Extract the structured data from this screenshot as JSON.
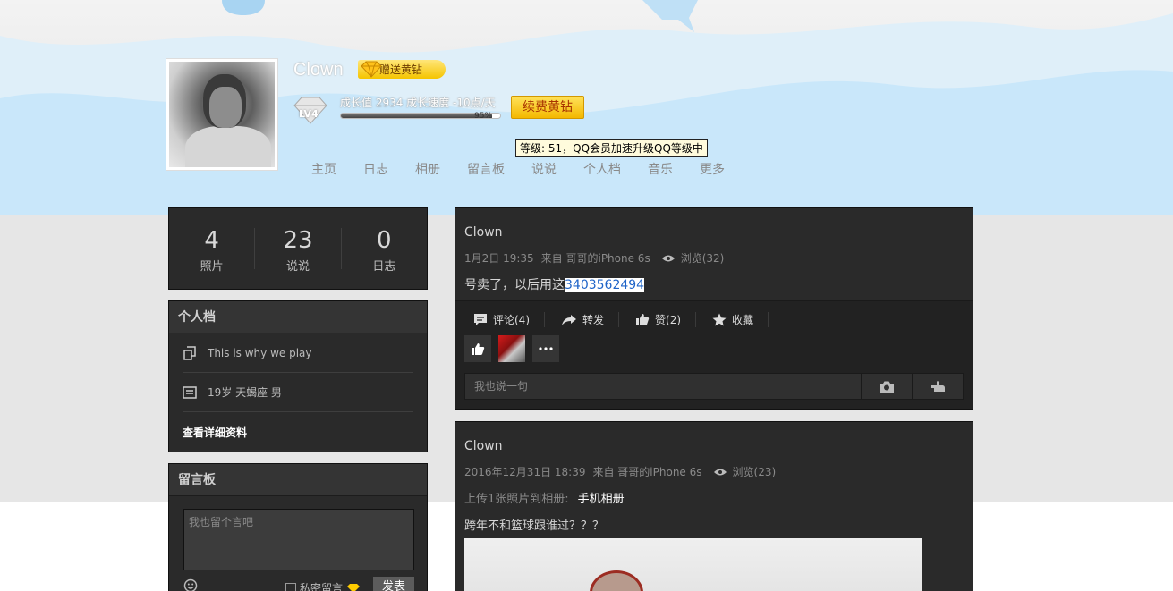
{
  "header": {
    "username": "Clown",
    "gift_badge": "赠送黄钻",
    "level_badge": "LV4",
    "growth_text": "成长值 2934   成长速度 -10点/天",
    "growth_progress": 0.95,
    "growth_percent": "95%",
    "renew_button": "续费黄钻",
    "tooltip": "等级: 51，QQ会员加速升级QQ等级中"
  },
  "nav": [
    "主页",
    "日志",
    "相册",
    "留言板",
    "说说",
    "个人档",
    "音乐",
    "更多"
  ],
  "stats": [
    {
      "num": "4",
      "label": "照片"
    },
    {
      "num": "23",
      "label": "说说"
    },
    {
      "num": "0",
      "label": "日志"
    }
  ],
  "profile": {
    "title": "个人档",
    "motto": "This is why we play",
    "info": "19岁  天蝎座  男",
    "detail_link": "查看详细资料"
  },
  "message_board": {
    "title": "留言板",
    "placeholder": "我也留个言吧",
    "private_label": "私密留言",
    "publish_button": "发表"
  },
  "feed": [
    {
      "name": "Clown",
      "time": "1月2日 19:35",
      "from": "来自 哥哥的iPhone 6s",
      "views": "浏览(32)",
      "content_prefix": "号卖了，以后用这",
      "content_highlight": "3403562494",
      "actions": {
        "comment": "评论(4)",
        "forward": "转发",
        "like": "赞(2)",
        "favorite": "收藏"
      },
      "comment_placeholder": "我也说一句"
    },
    {
      "name": "Clown",
      "time": "2016年12月31日 18:39",
      "from": "来自 哥哥的iPhone 6s",
      "views": "浏览(23)",
      "upload_text": "上传1张照片到相册:",
      "album": "手机相册",
      "caption": "跨年不和篮球跟谁过？？？"
    }
  ]
}
